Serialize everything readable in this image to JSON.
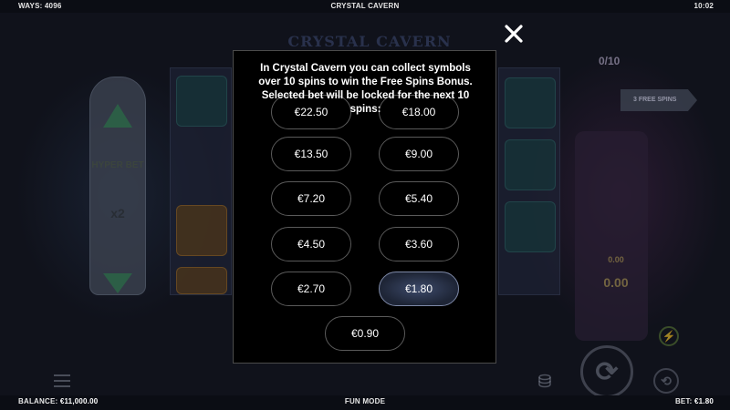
{
  "topbar": {
    "ways_label": "WAYS: 4096",
    "game_title": "CRYSTAL CAVERN",
    "clock": "10:02"
  },
  "background": {
    "logo_text": "CRYSTAL CAVERN",
    "hyper_bet_label": "HYPER BET",
    "hyper_bet_multiplier": "x2",
    "free_spins_counter": "0/10",
    "free_spins_sign": "3 FREE SPINS",
    "value_small": "0.00",
    "value_large": "0.00"
  },
  "modal": {
    "description": "In Crystal Cavern you can collect symbols over 10 spins to win the Free Spins Bonus. Selected bet will be locked for the next 10 spins:",
    "bets": [
      {
        "label": "€22.50",
        "selected": false
      },
      {
        "label": "€18.00",
        "selected": false
      },
      {
        "label": "€13.50",
        "selected": false
      },
      {
        "label": "€9.00",
        "selected": false
      },
      {
        "label": "€7.20",
        "selected": false
      },
      {
        "label": "€5.40",
        "selected": false
      },
      {
        "label": "€4.50",
        "selected": false
      },
      {
        "label": "€3.60",
        "selected": false
      },
      {
        "label": "€2.70",
        "selected": false
      },
      {
        "label": "€1.80",
        "selected": true
      },
      {
        "label": "€0.90",
        "selected": false
      }
    ]
  },
  "bottombar": {
    "balance_label": "BALANCE:",
    "balance_value": "€11,000.00",
    "mode": "FUN MODE",
    "bet_label": "BET:",
    "bet_value": "€1.80"
  },
  "colors": {
    "modal_bg": "#000000",
    "button_border": "#5a5a5a",
    "selected_bg": "#2e3850",
    "text": "#ffffff"
  },
  "icons": {
    "close": "close-icon",
    "menu": "menu-icon",
    "spin": "spin-icon",
    "autoplay": "autoplay-icon",
    "turbo": "lightning-icon",
    "stake": "coin-stack-icon"
  }
}
